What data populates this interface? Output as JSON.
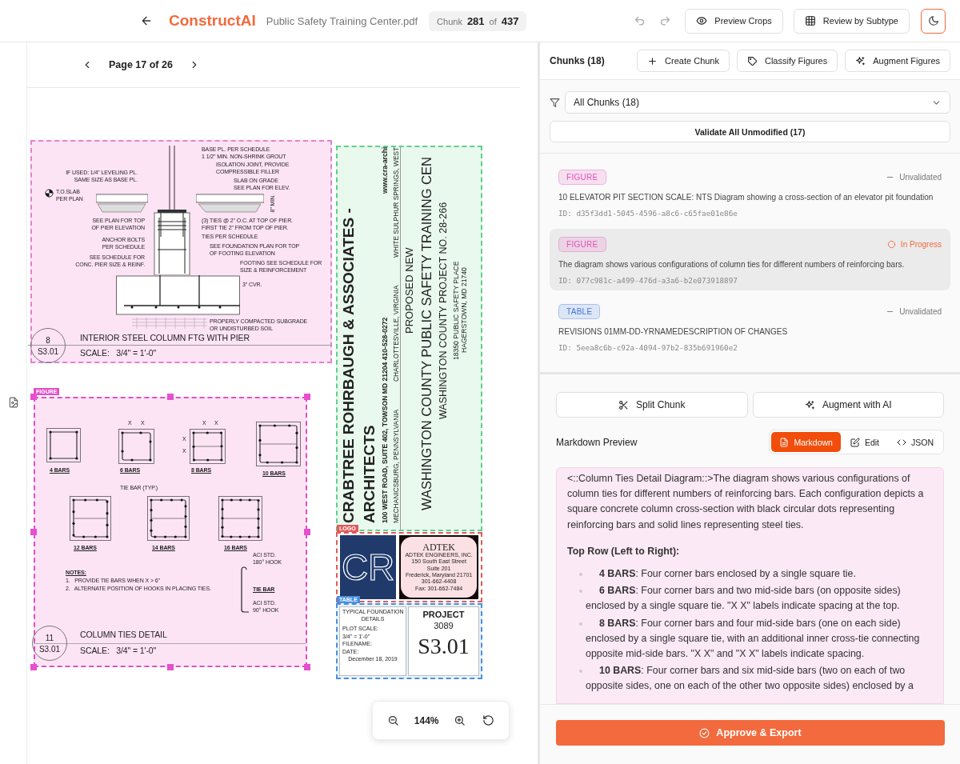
{
  "header": {
    "logo": "ConstructAI",
    "file_name": "Public Safety Training Center.pdf",
    "chunk_label": "Chunk",
    "chunk_current": "281",
    "chunk_of": "of",
    "chunk_total": "437",
    "buttons": [
      "Preview Crops",
      "Review by Subtype"
    ]
  },
  "viewer": {
    "page_label": "Page 17 of 26",
    "zoom": "144%"
  },
  "document": {
    "detail_8": {
      "number": "8",
      "sheet": "S3.01",
      "title": "INTERIOR STEEL COLUMN FTG WITH PIER",
      "scale": "SCALE:   3/4\" = 1'-0\"",
      "callouts": [
        "BASE PL. PER SCHEDULE",
        "1 1/2\" MIN. NON-SHRINK GROUT",
        "ISOLATION JOINT, PROVIDE\nCOMPRESSIBLE FILLER",
        "IF USED: 1/4\" LEVELING PL.\nSAME SIZE AS BASE PL.",
        "SLAB ON GRADE\nSEE PLAN FOR ELEV.",
        "T.O.SLAB\nPER PLAN",
        "8\" MIN.",
        "SEE PLAN FOR TOP\nOF PIER ELEVATION",
        "(3) TIES @ 2\" O.C. AT TOP OF PIER.\nFIRST TIE 2\" FROM TOP OF PIER.",
        "TIES PER SCHEDULE",
        "ANCHOR BOLTS\nPER SCHEDULE",
        "SEE SCHEDULE FOR\nCONC. PIER SIZE & REINF.",
        "SEE FOUNDATION PLAN FOR TOP\nOF FOOTING ELEVATION",
        "FOOTING SEE SCHEDULE FOR\nSIZE & REINFORCEMENT",
        "3\" CVR.",
        "PROPERLY COMPACTED SUBGRADE\nOR UNDISTURBED SOIL"
      ]
    },
    "detail_11": {
      "tag": "FIGURE",
      "number": "11",
      "sheet": "S3.01",
      "title": "COLUMN TIES DETAIL",
      "scale": "SCALE:   3/4\" = 1'-0\"",
      "sections": [
        "4 BARS",
        "6 BARS",
        "8 BARS",
        "10 BARS",
        "12 BARS",
        "14 BARS",
        "16 BARS"
      ],
      "dimension_labels": [
        "X",
        "X",
        "X",
        "X",
        "X",
        "X"
      ],
      "tie_bar_callout": "TIE BAR (TYP.)",
      "notes_heading": "NOTES:",
      "notes": [
        "1.   PROVIDE TIE BARS WHEN X > 6\"",
        "2.   ALTERNATE POSITION OF HOOKS IN PLACING TIES."
      ],
      "hook_top": "ACI STD.\n180° HOOK",
      "tie_bar_label": "TIE BAR",
      "hook_bottom": "ACI STD.\n90° HOOK"
    },
    "title_block": {
      "firm": "CRABTREE ROHRBAUGH & ASSOCIATES -",
      "firm_line2": "ARCHITECTS",
      "address": "100 WEST ROAD, SUITE 402, TOWSON  MD 21204  410-528-0272",
      "website": "www.cra-archi",
      "offices": [
        "MECHANICSBURG, PENNSYLVANIA",
        "CHARLOTTESVILLE, VIRGINIA",
        "WHITE SULPHUR SPRINGS, WEST"
      ],
      "project_intro": "PROPOSED NEW",
      "project_name": "WASHINGTON COUNTY PUBLIC SAFETY TRAINING CEN",
      "project_number": "WASHINGTON COUNTY PROJECT NO. 28-266",
      "site_address": [
        "18350 PUBLIC SAFETY PLACE",
        "HAGERSTOWN, MD 21740"
      ],
      "logo_tag": "LOGO",
      "logo_text": "CR",
      "engineer_name": "ADTEK",
      "engineer_lines": [
        "ADTEK ENGINEERS, INC.",
        "150 South East Street",
        "Suite 201",
        "Frederick, Maryland 21701",
        "301-662-4408",
        "Fax: 301-662-7484"
      ],
      "table_tag": "TABLE",
      "sheet_title": "TYPICAL FOUNDATION\nDETAILS",
      "plot_scale_label": "PLOT SCALE:",
      "plot_scale": "3/4\" = 1'-0\"",
      "filename_label": "FILENAME:",
      "date_label": "DATE:",
      "date": "December 18, 2019",
      "project_label": "PROJECT",
      "project_code": "3089",
      "sheet_number": "S3.01"
    }
  },
  "chunks": {
    "title": "Chunks (18)",
    "actions": [
      "Create Chunk",
      "Classify Figures",
      "Augment Figures"
    ],
    "filter": "All Chunks (18)",
    "validate": "Validate All Unmodified (17)",
    "items": [
      {
        "badge": "FIGURE",
        "color": "#e64fb9",
        "status": {
          "kind": "dash",
          "label": "Unvalidated"
        },
        "description": "10 ELEVATOR PIT SECTION SCALE: NTS Diagram showing a cross-section of an elevator pit foundation",
        "id": "ID: d35f3dd1-5045-4596-a8c6-c65fae01e86e",
        "selected": false
      },
      {
        "badge": "FIGURE",
        "color": "#e64fb9",
        "status": {
          "kind": "circle",
          "label": "In Progress"
        },
        "description": "The diagram shows various configurations of column ties for different numbers of reinforcing bars.",
        "id": "ID: 077c981c-a499-476d-a3a6-b2e073918897",
        "selected": true
      },
      {
        "badge": "TABLE",
        "color": "#3f76de",
        "status": {
          "kind": "dash",
          "label": "Unvalidated"
        },
        "description": "REVISIONS 01MM-DD-YRNAMEDESCRIPTION OF CHANGES",
        "id": "ID: 5eea8c6b-c92a-4094-97b2-835b691960e2",
        "selected": false
      }
    ]
  },
  "preview": {
    "actions": [
      "Split Chunk",
      "Augment with AI"
    ],
    "title": "Markdown Preview",
    "modes": [
      {
        "label": "Markdown",
        "selected": true
      },
      {
        "label": "Edit",
        "selected": false
      },
      {
        "label": "JSON",
        "selected": false
      }
    ],
    "intro": "<::Column Ties Detail Diagram::>The diagram shows various configurations of column ties for different numbers of reinforcing bars. Each configuration depicts a square concrete column cross-section with black circular dots representing reinforcing bars and solid lines representing steel ties.",
    "heading": "Top Row (Left to Right):",
    "items": [
      "**4 BARS**: Four corner bars enclosed by a single square tie.",
      "**6 BARS**: Four corner bars and two mid-side bars (on opposite sides) enclosed by a single square tie. \"X X\" labels indicate spacing at the top.",
      "**8 BARS**: Four corner bars and four mid-side bars (one on each side) enclosed by a single square tie, with an additional inner cross-tie connecting opposite mid-side bars. \"X X\" and \"X X\" labels indicate spacing.",
      "**10 BARS**: Four corner bars and six mid-side bars (two on each of two opposite sides, one on each of the other two opposite sides) enclosed by a"
    ]
  },
  "approve": "Approve & Export"
}
